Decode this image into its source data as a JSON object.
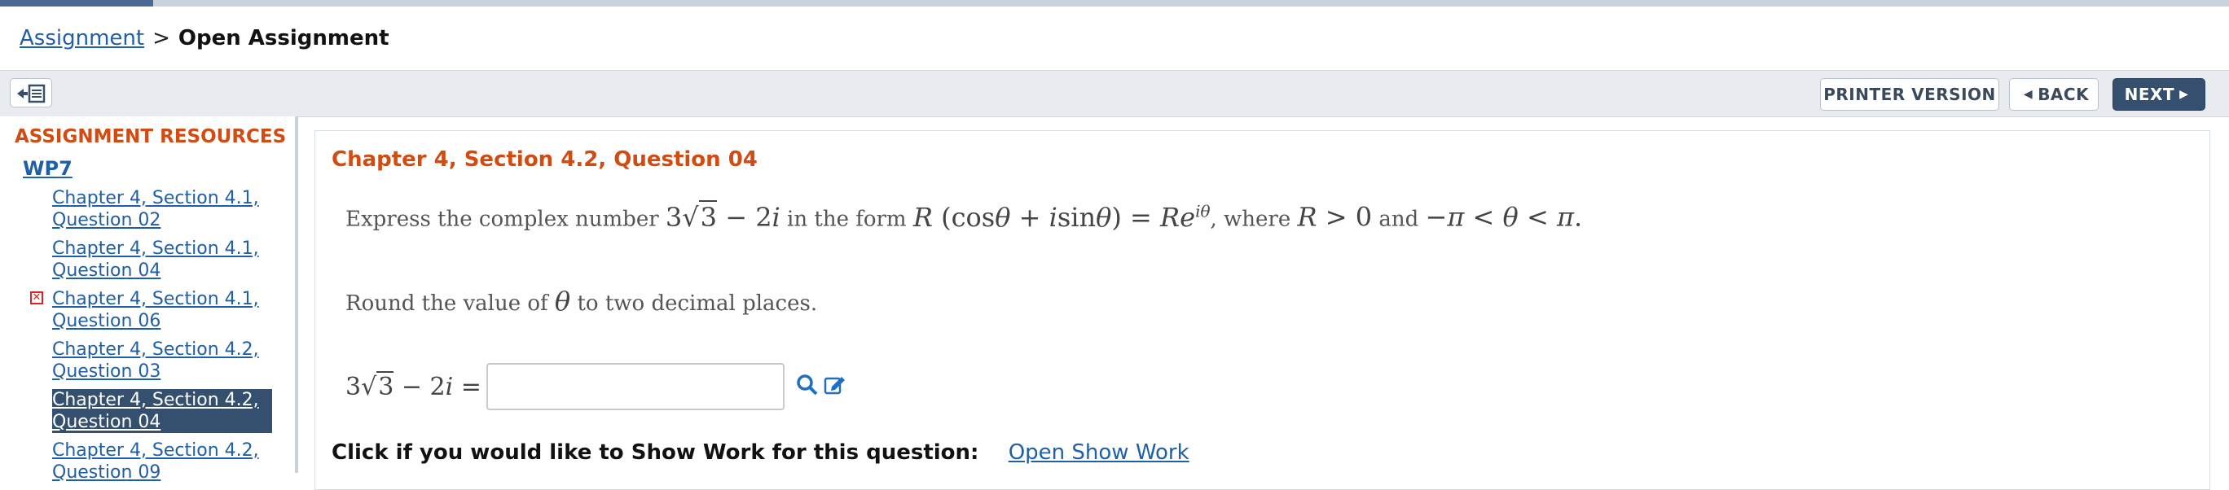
{
  "breadcrumb": {
    "link": "Assignment",
    "separator": ">",
    "current": "Open Assignment"
  },
  "toolbar": {
    "toggle_icon": "sidebar-toggle-icon",
    "printer_label": "PRINTER VERSION",
    "back_label": "BACK",
    "next_label": "NEXT",
    "accent_color": "#34506e"
  },
  "sidebar": {
    "title": "ASSIGNMENT RESOURCES",
    "group": "WP7",
    "items": [
      {
        "line1": "Chapter 4, Section 4.1,",
        "line2": "Question 02"
      },
      {
        "line1": "Chapter 4, Section 4.1,",
        "line2": "Question 04"
      },
      {
        "line1": "Chapter 4, Section 4.1,",
        "line2": "Question 06",
        "status": "incorrect"
      },
      {
        "line1": "Chapter 4, Section 4.2,",
        "line2": "Question 03"
      },
      {
        "line1": "Chapter 4, Section 4.2,",
        "line2": "Question 04",
        "active": true
      },
      {
        "line1": "Chapter 4, Section 4.2,",
        "line2": "Question 09"
      }
    ],
    "title_color": "#d24b10"
  },
  "main": {
    "question_title": "Chapter 4, Section 4.2, Question 04",
    "prompt_part1": "Express the complex number",
    "prompt_part2": "in the form",
    "prompt_part3": ", where",
    "prompt_part4": "and",
    "prompt_round": "Round the value of",
    "prompt_round_end": "to two decimal places.",
    "show_work_label": "Click if you would like to Show Work for this question:",
    "show_work_link": "Open Show Work",
    "answer_value": ""
  }
}
